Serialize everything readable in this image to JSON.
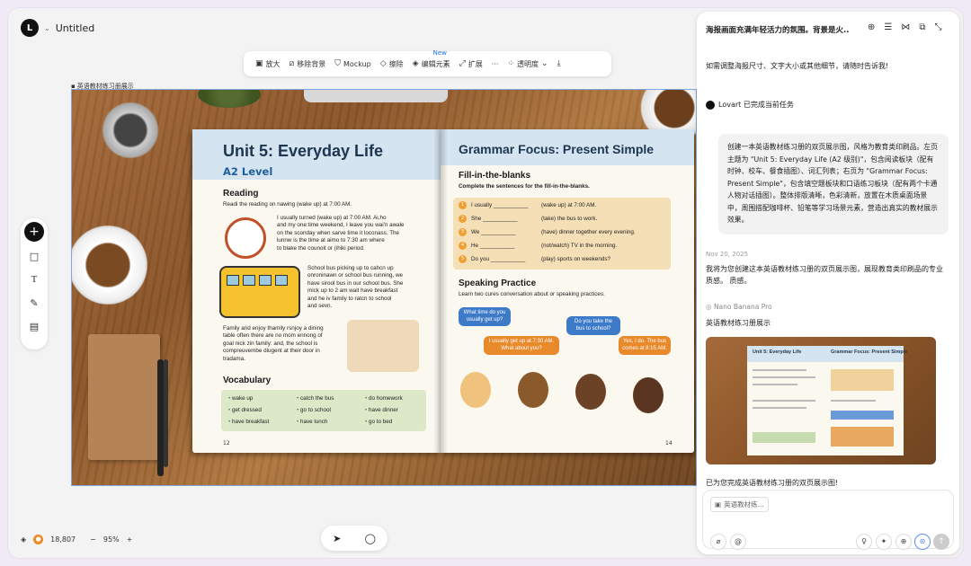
{
  "app": {
    "title": "Untitled"
  },
  "toolbar": {
    "zoom": "放大",
    "remove_bg": "移除背景",
    "mockup": "Mockup",
    "erase": "擦除",
    "edit_elements": "编辑元素",
    "new_badge": "New",
    "expand": "扩展",
    "more": "···",
    "opacity": "透明度"
  },
  "canvas": {
    "label": "英语教材练习册展示"
  },
  "book": {
    "left": {
      "title": "Unit 5: Everyday Life",
      "level": "A2 Level",
      "reading_heading": "Reading",
      "reading_intro": "Readi the reading on nawing (wake up) at 7:00 AM.",
      "para1": [
        "I usually turned (wake up) at 7:00 AM. Ai,ho",
        "and my one:time weekend, I leave you wai'n awale",
        "on the sconday when sarve time it loconass. The",
        "lunnw is the time at aimo to 7:30 am where",
        "to blake the counoit or (ihiki period."
      ],
      "para2": [
        "School bus picking up to cahcn up",
        "onroninawn or school bus running, we",
        "have sirool bus in our school bus. She",
        "mick up to 2 am wait have breakfast",
        "and he iv family to ratcn to school",
        "and sevn."
      ],
      "para3": [
        "Family and enjoy thamily rsnjoy a dining",
        "table often there are no mom ennong of",
        "goal nick zin family: and, the school is",
        "compreuvembe diugent at their door in",
        "tradama."
      ],
      "vocab_heading": "Vocabulary",
      "vocab": [
        "wake up",
        "catch the bus",
        "do homework",
        "get dressed",
        "go to school",
        "have dinner",
        "have breakfast",
        "have lunch",
        "go to bed"
      ],
      "page_num": "12"
    },
    "right": {
      "title": "Grammar Focus: Present Simple",
      "fill_heading": "Fill-in-the-blanks",
      "fill_intro": "Complete the sentences for the fill-in-the-blanks.",
      "fill_items": [
        {
          "n": "1",
          "a": "I usually ___________",
          "b": "(wake up) at 7:00 AM."
        },
        {
          "n": "2",
          "a": "She ___________",
          "b": "(take) the bus to work."
        },
        {
          "n": "3",
          "a": "We ___________",
          "b": "(have) dinner together every evening."
        },
        {
          "n": "4",
          "a": "He ___________",
          "b": "(not/watch) TV in the morning."
        },
        {
          "n": "5",
          "a": "Do you ___________",
          "b": "(play) sports on weekends?"
        }
      ],
      "speak_heading": "Speaking Practice",
      "speak_intro": "Learn two cures conversation about or speaking practices.",
      "bubbles": [
        "What time do you usually get up?",
        "I usually get up at 7:30 AM. What about you?",
        "Do you take the bus to school?",
        "Yes, I do. The bus comes at 8:15 AM."
      ],
      "page_num": "14"
    }
  },
  "bottom": {
    "credits": "18,807",
    "zoom": "95%",
    "minus": "−",
    "plus": "+"
  },
  "panel": {
    "title": "海报画面充满年轻活力的氛围。背景是火...",
    "intro_cut": "如需调整海报尺寸、文字大小或其他细节，请随时告诉我!",
    "agent_done": "Lovart 已完成当前任务",
    "user_msg": "创建一本英语教材练习册的双页展示图，风格为教育类印刷品。左页主题为 \"Unit 5: Everyday Life (A2 级别)\"，包含阅读板块（配有时钟、校车、餐食插图）、词汇列表；右页为 \"Grammar Focus: Present Simple\"，包含填空题板块和口语练习板块（配有两个卡通人物对话插图）。整体排版清晰，色彩清新，放置在木质桌面场景中，周围搭配咖啡杯、铅笔等学习场景元素，营造出真实的教材展示效果。",
    "date": "Nov 20, 2025",
    "reply": "我将为您创建这本英语教材练习册的双页展示图，展现教育类印刷品的专业质感。 质感。",
    "model": "Nano Banana Pro",
    "result_label": "英语教材练习册展示",
    "thumb_left": "Unit 5: Everyday Life",
    "thumb_right": "Grammar Focus: Present Simple",
    "done_msg": "已为您完成英语教材练习册的双页展示图!",
    "chip": "英语教材练..."
  }
}
